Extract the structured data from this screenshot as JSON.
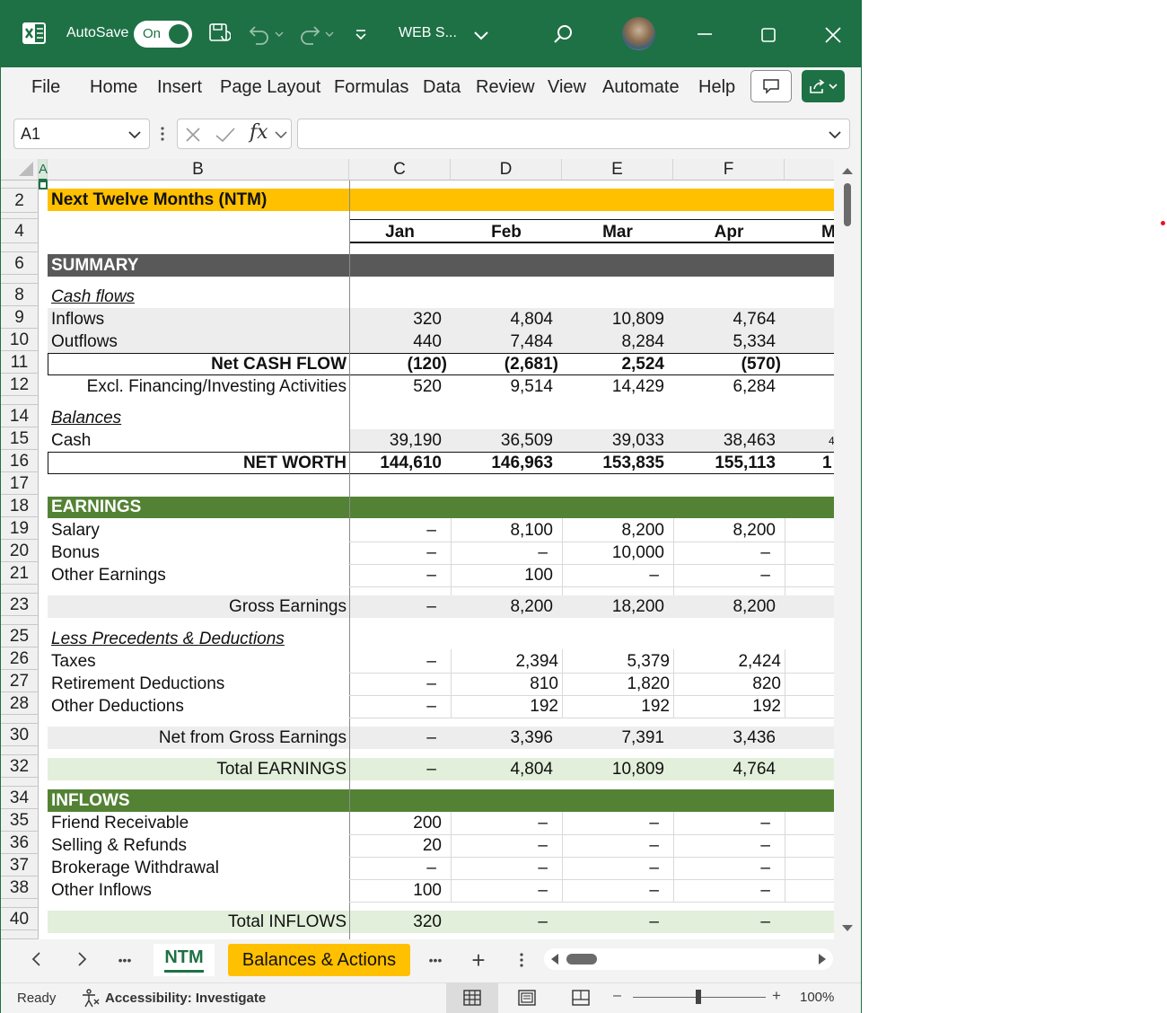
{
  "titlebar": {
    "autosave_label": "AutoSave",
    "toggle_state": "On",
    "file_name": "WEB S...",
    "brand_color": "#1e7145"
  },
  "ribbon": {
    "tabs": [
      "File",
      "Home",
      "Insert",
      "Page Layout",
      "Formulas",
      "Data",
      "Review",
      "View",
      "Automate",
      "Help"
    ]
  },
  "formula_bar": {
    "name_box": "A1",
    "fx_label": "fx",
    "formula": ""
  },
  "columns": [
    "A",
    "B",
    "C",
    "D",
    "E",
    "F"
  ],
  "row_numbers": [
    "2",
    "4",
    "6",
    "8",
    "9",
    "10",
    "11",
    "12",
    "14",
    "15",
    "16",
    "17",
    "18",
    "19",
    "20",
    "21",
    "23",
    "25",
    "26",
    "27",
    "28",
    "30",
    "32",
    "34",
    "35",
    "36",
    "37",
    "38",
    "40"
  ],
  "sheet": {
    "title": "Next Twelve Months (NTM)",
    "months": [
      "Jan",
      "Feb",
      "Mar",
      "Apr",
      "M"
    ],
    "summary_header": "SUMMARY",
    "cash_flows_label": "Cash flows",
    "inflows_row": {
      "label": "Inflows",
      "values": [
        "320",
        "4,804",
        "10,809",
        "4,764"
      ]
    },
    "outflows_row": {
      "label": "Outflows",
      "values": [
        "440",
        "7,484",
        "8,284",
        "5,334"
      ]
    },
    "net_cash_flow_row": {
      "label": "Net CASH FLOW",
      "values": [
        "(120)",
        "(2,681)",
        "2,524",
        "(570)"
      ]
    },
    "excl_row": {
      "label": "Excl. Financing/Investing Activities",
      "values": [
        "520",
        "9,514",
        "14,429",
        "6,284"
      ]
    },
    "balances_label": "Balances",
    "cash_row": {
      "label": "Cash",
      "values": [
        "39,190",
        "36,509",
        "39,033",
        "38,463"
      ],
      "overflow": "4"
    },
    "net_worth_row": {
      "label": "NET WORTH",
      "values": [
        "144,610",
        "146,963",
        "153,835",
        "155,113"
      ],
      "overflow": "1"
    },
    "earnings_header": "EARNINGS",
    "salary_row": {
      "label": "Salary",
      "values": [
        "–",
        "8,100",
        "8,200",
        "8,200"
      ]
    },
    "bonus_row": {
      "label": "Bonus",
      "values": [
        "–",
        "–",
        "10,000",
        "–"
      ]
    },
    "other_earnings_row": {
      "label": "Other Earnings",
      "values": [
        "–",
        "100",
        "–",
        "–"
      ]
    },
    "gross_earnings_row": {
      "label": "Gross Earnings",
      "values": [
        "–",
        "8,200",
        "18,200",
        "8,200"
      ]
    },
    "less_label": "Less Precedents & Deductions",
    "taxes_row": {
      "label": "Taxes",
      "values": [
        "–",
        "2,394",
        "5,379",
        "2,424"
      ]
    },
    "retirement_row": {
      "label": "Retirement Deductions",
      "values": [
        "–",
        "810",
        "1,820",
        "820"
      ]
    },
    "other_deductions_row": {
      "label": "Other Deductions",
      "values": [
        "–",
        "192",
        "192",
        "192"
      ]
    },
    "net_gross_row": {
      "label": "Net from Gross Earnings",
      "values": [
        "–",
        "3,396",
        "7,391",
        "3,436"
      ]
    },
    "total_earnings_row": {
      "label": "Total EARNINGS",
      "values": [
        "–",
        "4,804",
        "10,809",
        "4,764"
      ]
    },
    "inflows_header": "INFLOWS",
    "friend_row": {
      "label": "Friend Receivable",
      "values": [
        "200",
        "–",
        "–",
        "–"
      ]
    },
    "selling_row": {
      "label": "Selling & Refunds",
      "values": [
        "20",
        "–",
        "–",
        "–"
      ]
    },
    "brokerage_row": {
      "label": "Brokerage Withdrawal",
      "values": [
        "–",
        "–",
        "–",
        "–"
      ]
    },
    "other_inflows_row": {
      "label": "Other Inflows",
      "values": [
        "100",
        "–",
        "–",
        "–"
      ]
    },
    "total_inflows_row": {
      "label": "Total INFLOWS",
      "values": [
        "320",
        "–",
        "–",
        "–"
      ]
    }
  },
  "sheet_tabs": {
    "active": "NTM",
    "second": "Balances & Actions",
    "more": "•••",
    "add": "+"
  },
  "statusbar": {
    "ready": "Ready",
    "accessibility": "Accessibility: Investigate",
    "zoom": "100%",
    "zoom_minus": "–",
    "zoom_plus": "+"
  },
  "colors": {
    "title_band": "#ffc000",
    "summary_band": "#595959",
    "section_green": "#548235",
    "gray_fill": "#ededed",
    "light_green": "#e2efda"
  }
}
